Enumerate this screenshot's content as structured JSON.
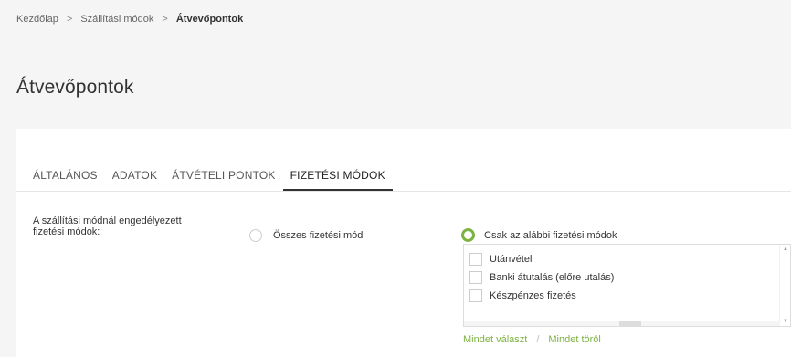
{
  "breadcrumb": {
    "items": [
      "Kezdőlap",
      "Szállítási módok",
      "Átvevőpontok"
    ],
    "separator": ">"
  },
  "page_title": "Átvevőpontok",
  "tabs": [
    {
      "label": "ÁLTALÁNOS",
      "active": false
    },
    {
      "label": "ADATOK",
      "active": false
    },
    {
      "label": "ÁTVÉTELI PONTOK",
      "active": false
    },
    {
      "label": "FIZETÉSI MÓDOK",
      "active": true
    }
  ],
  "form": {
    "label_line1": "A szállítási módnál engedélyezett",
    "label_line2": "fizetési módok:",
    "option_all": "Összes fizetési mód",
    "option_selected": "Csak az alábbi fizetési módok",
    "selected_option": "option_selected",
    "payment_methods": [
      {
        "label": "Utánvétel",
        "checked": false
      },
      {
        "label": "Banki átutalás (előre utalás)",
        "checked": false
      },
      {
        "label": "Készpénzes fizetés",
        "checked": false
      }
    ],
    "select_all": "Mindet választ",
    "action_separator": "/",
    "clear_all": "Mindet töröl"
  },
  "colors": {
    "accent": "#7cb342",
    "background": "#f5f5f5",
    "card": "#ffffff"
  }
}
